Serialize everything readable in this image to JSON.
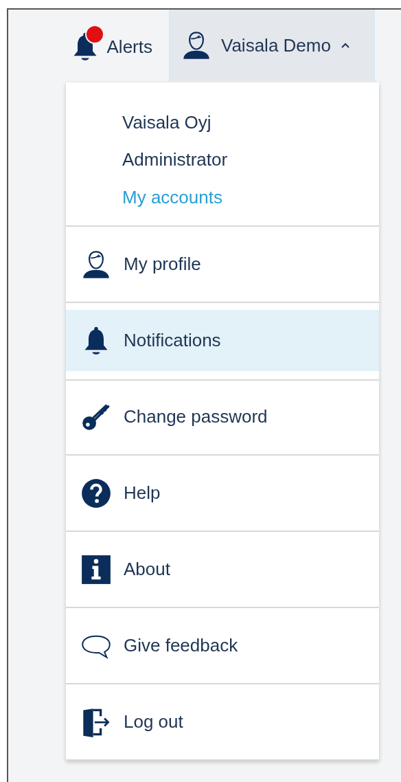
{
  "header": {
    "alerts": {
      "label": "Alerts",
      "unread": true
    },
    "user_menu": {
      "label": "Vaisala Demo",
      "expanded": true
    }
  },
  "account": {
    "organization": "Vaisala Oyj",
    "role": "Administrator",
    "link": "My accounts"
  },
  "menu_items": [
    {
      "label": "My profile",
      "selected": false
    },
    {
      "label": "Notifications",
      "selected": true
    },
    {
      "label": "Change password",
      "selected": false
    },
    {
      "label": "Help",
      "selected": false
    },
    {
      "label": "About",
      "selected": false
    },
    {
      "label": "Give feedback",
      "selected": false
    },
    {
      "label": "Log out",
      "selected": false
    }
  ]
}
